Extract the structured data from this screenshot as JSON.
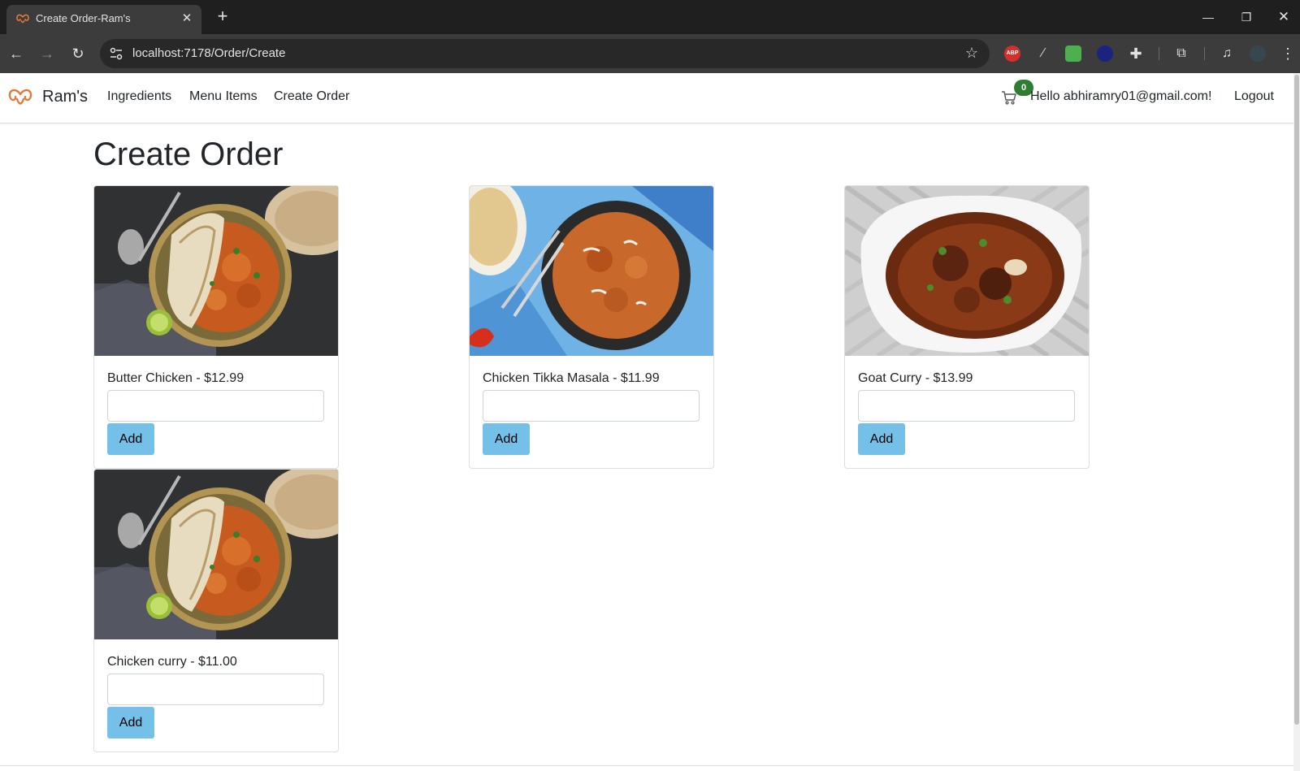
{
  "browser": {
    "tab_title": "Create Order-Ram's",
    "tab_close": "✕",
    "new_tab": "+",
    "url": "localhost:7178/Order/Create",
    "extensions": [
      "ABP",
      "feather",
      "green-ext",
      "compass-ext",
      "puzzle",
      "cast-search",
      "media",
      "profile"
    ],
    "window_controls": {
      "minimize": "—",
      "restore": "❐",
      "close": "✕"
    }
  },
  "site": {
    "brand": "Ram's",
    "nav": {
      "ingredients": "Ingredients",
      "menu_items": "Menu Items",
      "create_order": "Create Order"
    },
    "cart_count": "0",
    "greeting": "Hello abhiramry01@gmail.com!",
    "logout": "Logout",
    "accent": "#74c0e8",
    "badge_color": "#2e7d32"
  },
  "page": {
    "title": "Create Order",
    "items": [
      {
        "label": "Butter Chicken - $12.99",
        "quantity": "",
        "add": "Add",
        "photo": "butter-chicken"
      },
      {
        "label": "Chicken Tikka Masala - $11.99",
        "quantity": "",
        "add": "Add",
        "photo": "tikka-masala"
      },
      {
        "label": "Goat Curry - $13.99",
        "quantity": "",
        "add": "Add",
        "photo": "goat-curry"
      },
      {
        "label": "Chicken curry - $11.00",
        "quantity": "",
        "add": "Add",
        "photo": "butter-chicken"
      }
    ]
  }
}
